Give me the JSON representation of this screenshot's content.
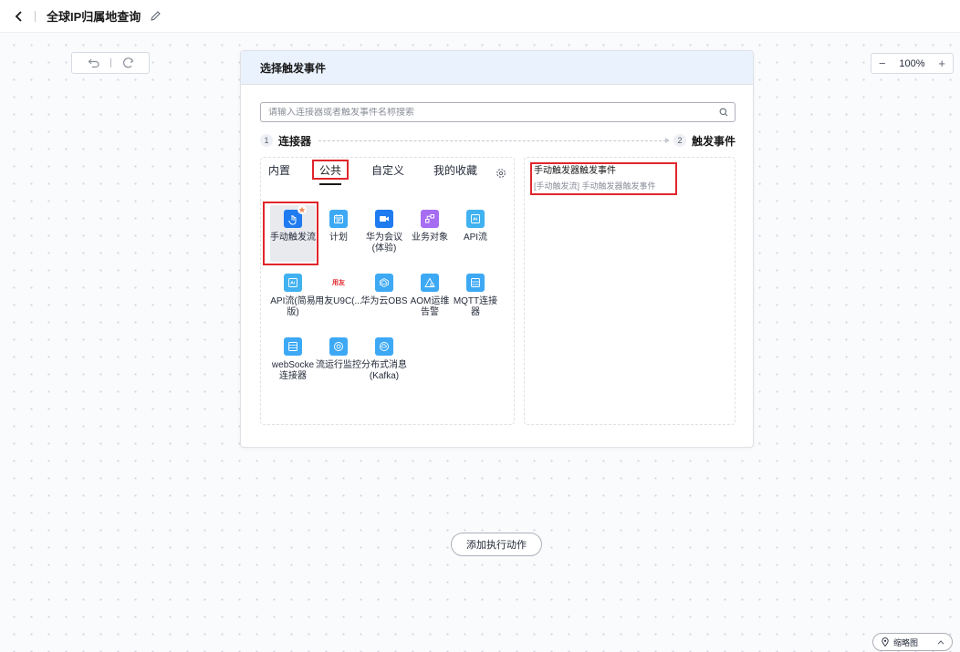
{
  "header": {
    "title": "全球IP归属地查询"
  },
  "toolbar": {
    "zoom_minus": "−",
    "zoom_level": "100%",
    "zoom_plus": "+"
  },
  "modal": {
    "title": "选择触发事件",
    "search_placeholder": "请输入连接器或者触发事件名称搜索",
    "step1_num": "1",
    "step1_label": "连接器",
    "step2_num": "2",
    "step2_label": "触发事件",
    "tabs": [
      {
        "label": "内置"
      },
      {
        "label": "公共"
      },
      {
        "label": "自定义"
      },
      {
        "label": "我的收藏"
      }
    ],
    "connectors": [
      {
        "label": "手动触发流",
        "icon": "hand-touch-icon",
        "color": "#1e7bf0"
      },
      {
        "label": "计划",
        "icon": "calendar-icon",
        "color": "#3da9f5"
      },
      {
        "label": "华为会议(体验)",
        "icon": "video-camera-icon",
        "color": "#1e7bf0"
      },
      {
        "label": "业务对象",
        "icon": "object-icon",
        "color": "#a66cf2"
      },
      {
        "label": "API流",
        "icon": "api-icon",
        "color": "#41b2f0"
      },
      {
        "label": "API流(简易版)",
        "icon": "api-icon",
        "color": "#41b2f0"
      },
      {
        "label": "用友U9C(...",
        "icon": "yonyou-logo-icon",
        "color": "#ffffff"
      },
      {
        "label": "华为云OBS",
        "icon": "cloud-icon",
        "color": "#3da9f5"
      },
      {
        "label": "AOM运维告警",
        "icon": "alarm-icon",
        "color": "#3da9f5"
      },
      {
        "label": "MQTT连接器",
        "icon": "mqtt-icon",
        "color": "#3da9f5"
      },
      {
        "label": "webSocke连接器",
        "icon": "websocket-icon",
        "color": "#3da9f5"
      },
      {
        "label": "流运行监控",
        "icon": "monitor-icon",
        "color": "#3da9f5"
      },
      {
        "label": "分布式消息(Kafka)",
        "icon": "kafka-icon",
        "color": "#3da9f5"
      }
    ],
    "yonyou_text": "用友",
    "event": {
      "title": "手动触发器触发事件",
      "desc": "[手动触发流] 手动触发器触发事件"
    }
  },
  "canvas": {
    "add_action_label": "添加执行动作",
    "thumbnail_label": "缩略图"
  }
}
